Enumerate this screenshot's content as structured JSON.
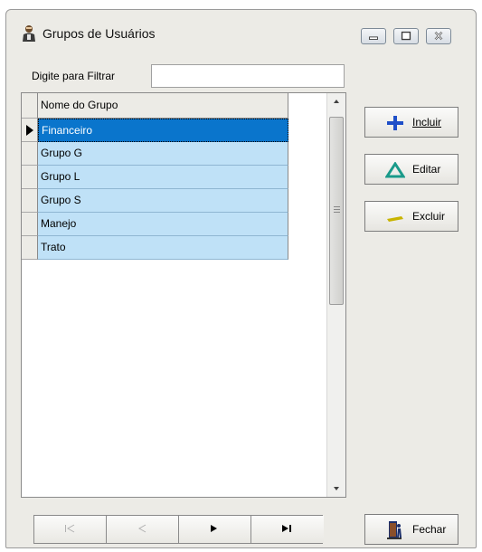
{
  "window": {
    "title": "Grupos de Usuários",
    "title_icon": "users-icon",
    "buttons": [
      "minimize-icon",
      "maximize-icon",
      "close-icon"
    ]
  },
  "filter": {
    "label": "Digite para Filtrar",
    "value": ""
  },
  "grid": {
    "column_header": "Nome do Grupo",
    "rows": [
      "Financeiro",
      "Grupo G",
      "Grupo L",
      "Grupo S",
      "Manejo",
      "Trato"
    ],
    "selected_index": 0
  },
  "actions": {
    "incluir": "Incluir",
    "editar": "Editar",
    "excluir": "Excluir",
    "fechar": "Fechar"
  },
  "navigator": [
    "first-record-icon",
    "prior-record-icon",
    "next-record-icon",
    "last-record-icon"
  ],
  "colors": {
    "row_bg": "#bfe1f7",
    "selected_bg": "#0a75cc",
    "incluir_icon": "#1f4fc8",
    "editar_icon": "#1a9a8a",
    "excluir_icon": "#c8b400"
  }
}
